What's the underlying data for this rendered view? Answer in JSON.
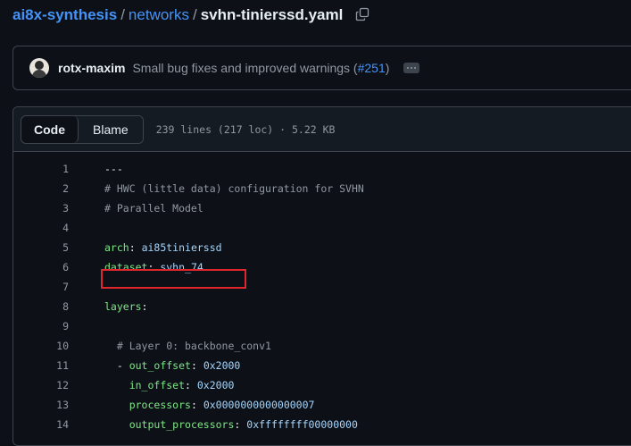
{
  "breadcrumb": {
    "repo": "ai8x-synthesis",
    "sep1": "/",
    "dir": "networks",
    "sep2": "/",
    "file": "svhn-tinierssd.yaml",
    "copy_icon": "copy-icon"
  },
  "commit": {
    "author": "rotx-maxim",
    "message": "Small bug fixes and improved warnings (",
    "pr": "#251",
    "message_end": ")",
    "more_icon": "kebab-horizontal-icon"
  },
  "file_header": {
    "tab_code": "Code",
    "tab_blame": "Blame",
    "info": "239 lines (217 loc) · 5.22 KB"
  },
  "code_lines": [
    {
      "n": "1",
      "parts": [
        {
          "t": "---",
          "c": "plain"
        }
      ]
    },
    {
      "n": "2",
      "parts": [
        {
          "t": "# HWC (little data) configuration for SVHN",
          "c": "comment"
        }
      ]
    },
    {
      "n": "3",
      "parts": [
        {
          "t": "# Parallel Model",
          "c": "comment"
        }
      ]
    },
    {
      "n": "4",
      "parts": []
    },
    {
      "n": "5",
      "parts": [
        {
          "t": "arch",
          "c": "key"
        },
        {
          "t": ": ",
          "c": "plain"
        },
        {
          "t": "ai85tinierssd",
          "c": "val"
        }
      ]
    },
    {
      "n": "6",
      "parts": [
        {
          "t": "dataset",
          "c": "key"
        },
        {
          "t": ": ",
          "c": "plain"
        },
        {
          "t": "svhn_74",
          "c": "val"
        }
      ]
    },
    {
      "n": "7",
      "parts": []
    },
    {
      "n": "8",
      "parts": [
        {
          "t": "layers",
          "c": "key"
        },
        {
          "t": ":",
          "c": "plain"
        }
      ]
    },
    {
      "n": "9",
      "parts": []
    },
    {
      "n": "10",
      "parts": [
        {
          "t": "  # Layer 0: backbone_conv1",
          "c": "comment"
        }
      ]
    },
    {
      "n": "11",
      "parts": [
        {
          "t": "  - ",
          "c": "plain"
        },
        {
          "t": "out_offset",
          "c": "key"
        },
        {
          "t": ": ",
          "c": "plain"
        },
        {
          "t": "0x2000",
          "c": "val"
        }
      ]
    },
    {
      "n": "12",
      "parts": [
        {
          "t": "    ",
          "c": "plain"
        },
        {
          "t": "in_offset",
          "c": "key"
        },
        {
          "t": ": ",
          "c": "plain"
        },
        {
          "t": "0x2000",
          "c": "val"
        }
      ]
    },
    {
      "n": "13",
      "parts": [
        {
          "t": "    ",
          "c": "plain"
        },
        {
          "t": "processors",
          "c": "key"
        },
        {
          "t": ": ",
          "c": "plain"
        },
        {
          "t": "0x0000000000000007",
          "c": "val"
        }
      ]
    },
    {
      "n": "14",
      "parts": [
        {
          "t": "    ",
          "c": "plain"
        },
        {
          "t": "output_processors",
          "c": "key"
        },
        {
          "t": ": ",
          "c": "plain"
        },
        {
          "t": "0xffffffff00000000",
          "c": "val"
        }
      ]
    }
  ],
  "colors": {
    "background": "#0d1117",
    "link": "#4493f8",
    "yaml_key": "#7ee787",
    "yaml_value": "#a5d6ff",
    "comment": "#9198a1",
    "highlight_box": "#e0282c"
  }
}
